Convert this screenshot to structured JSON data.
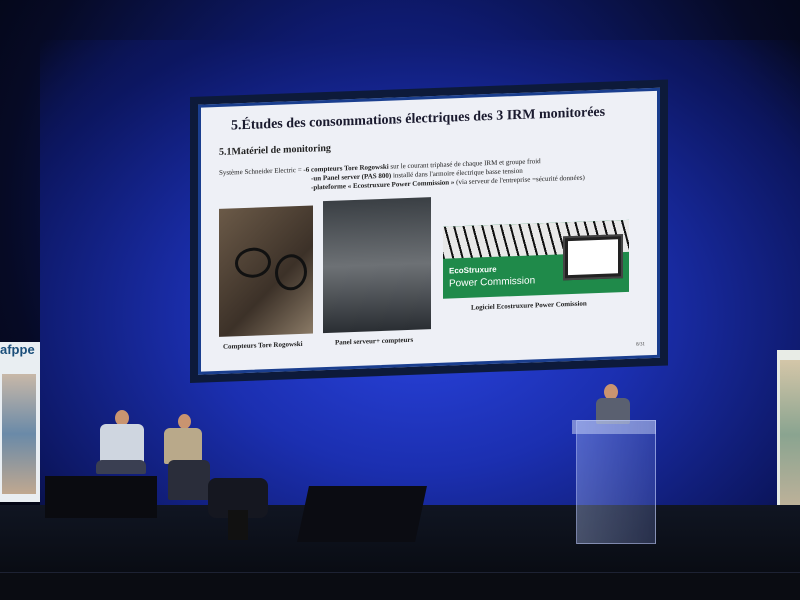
{
  "slide": {
    "title": "5.Études des consommations électriques des 3 IRM monitorées",
    "subtitle": "5.1Matériel de monitoring",
    "system_label": "Système Schneider Electric = ",
    "lines": [
      {
        "bold": "-6 compteurs Tore Rogowski",
        "rest": "  sur le courant triphasé de chaque IRM et groupe froid"
      },
      {
        "bold": "-un Panel server (PAS 800)",
        "rest": " installé dans l'armoire électrique basse tension"
      },
      {
        "bold": "-plateforme « Ecostruxure Power Commission »",
        "rest": " (via serveur de l'entreprise =sécurité données)"
      }
    ],
    "captions": {
      "photo1": "Compteurs Tore Rogowski",
      "photo2": "Panel serveur+ compteurs",
      "photo3": "Logiciel Ecostruxure Power Comission"
    },
    "eco_brand": "EcoStruxure",
    "eco_product": "Power Commission",
    "page_number": "8/31"
  },
  "banner_left": {
    "logo": "afppe"
  },
  "colors": {
    "stage_blue": "#1b2fb0",
    "slide_border": "#1a3e8e",
    "eco_green": "#1f8a4a"
  }
}
